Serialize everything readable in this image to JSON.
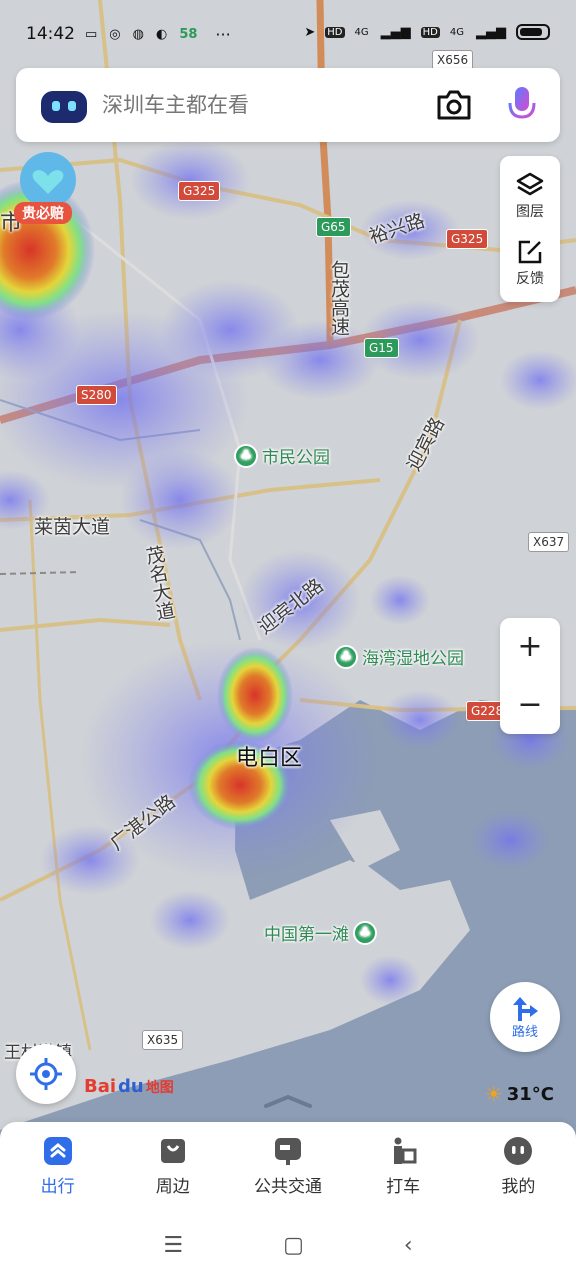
{
  "status_bar": {
    "time": "14:42",
    "network_1": "4G",
    "network_2": "4G",
    "hd_1": "HD",
    "hd_2": "HD",
    "app_badge": "58",
    "dots": "···"
  },
  "search": {
    "placeholder": "深圳车主都在看"
  },
  "badge": {
    "label": "贵必赔"
  },
  "side_panel": {
    "layers_label": "图层",
    "feedback_label": "反馈"
  },
  "zoom": {
    "plus": "+",
    "minus": "−"
  },
  "route_button": {
    "label": "路线"
  },
  "map": {
    "roads": {
      "g325_a": "G325",
      "g325_b": "G325",
      "g65": "G65",
      "g15": "G15",
      "s280": "S280",
      "g228": "G228",
      "x656": "X656",
      "x637": "X637",
      "x635": "X635"
    },
    "labels": {
      "yuxing_road": "裕兴路",
      "baomao_highway": "包茂高速",
      "laiyin_avenue": "莱茵大道",
      "maoming_avenue": "茂名大道",
      "yingbin_road": "迎宾路",
      "yingbin_north_road": "迎宾北路",
      "guangzhan_road": "广湛公路",
      "dianbai_district": "电白区",
      "wang_town": "王村港镇",
      "city_edge": "市"
    },
    "pois": {
      "citizen_park": "市民公园",
      "bay_wetland_park": "海湾湿地公园",
      "china_first_beach": "中国第一滩"
    }
  },
  "logo": {
    "bai": "Bai",
    "du": "du",
    "tu": "地图"
  },
  "weather": {
    "temp": "31°C"
  },
  "tabs": [
    {
      "label": "出行",
      "active": true
    },
    {
      "label": "周边",
      "active": false
    },
    {
      "label": "公共交通",
      "active": false
    },
    {
      "label": "打车",
      "active": false
    },
    {
      "label": "我的",
      "active": false
    }
  ],
  "colors": {
    "accent": "#2f6ee8",
    "water": "#8c9db5",
    "land": "#cfd2d6"
  }
}
